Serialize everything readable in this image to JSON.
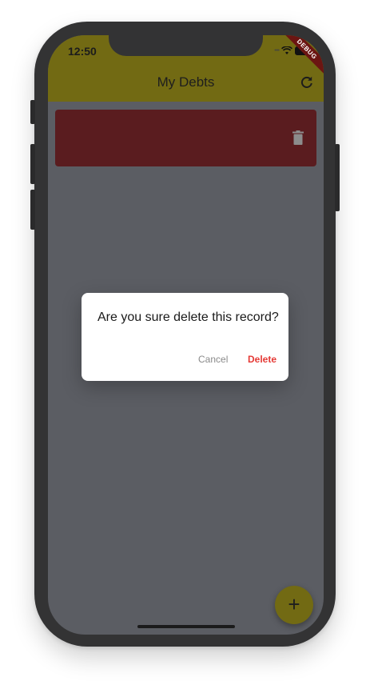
{
  "status_bar": {
    "time": "12:50"
  },
  "debug_banner": "DEBUG",
  "app_bar": {
    "title": "My Debts",
    "refresh_icon": "refresh-icon"
  },
  "records": [
    {
      "delete_icon": "trash-icon"
    }
  ],
  "dialog": {
    "message": "Are you sure delete this record?",
    "cancel_label": "Cancel",
    "delete_label": "Delete"
  },
  "fab": {
    "label": "+"
  },
  "colors": {
    "app_bar": "#726a13",
    "record_card": "#5a1c1f",
    "scrim_background": "#5b5d63",
    "delete_text": "#e53935"
  }
}
